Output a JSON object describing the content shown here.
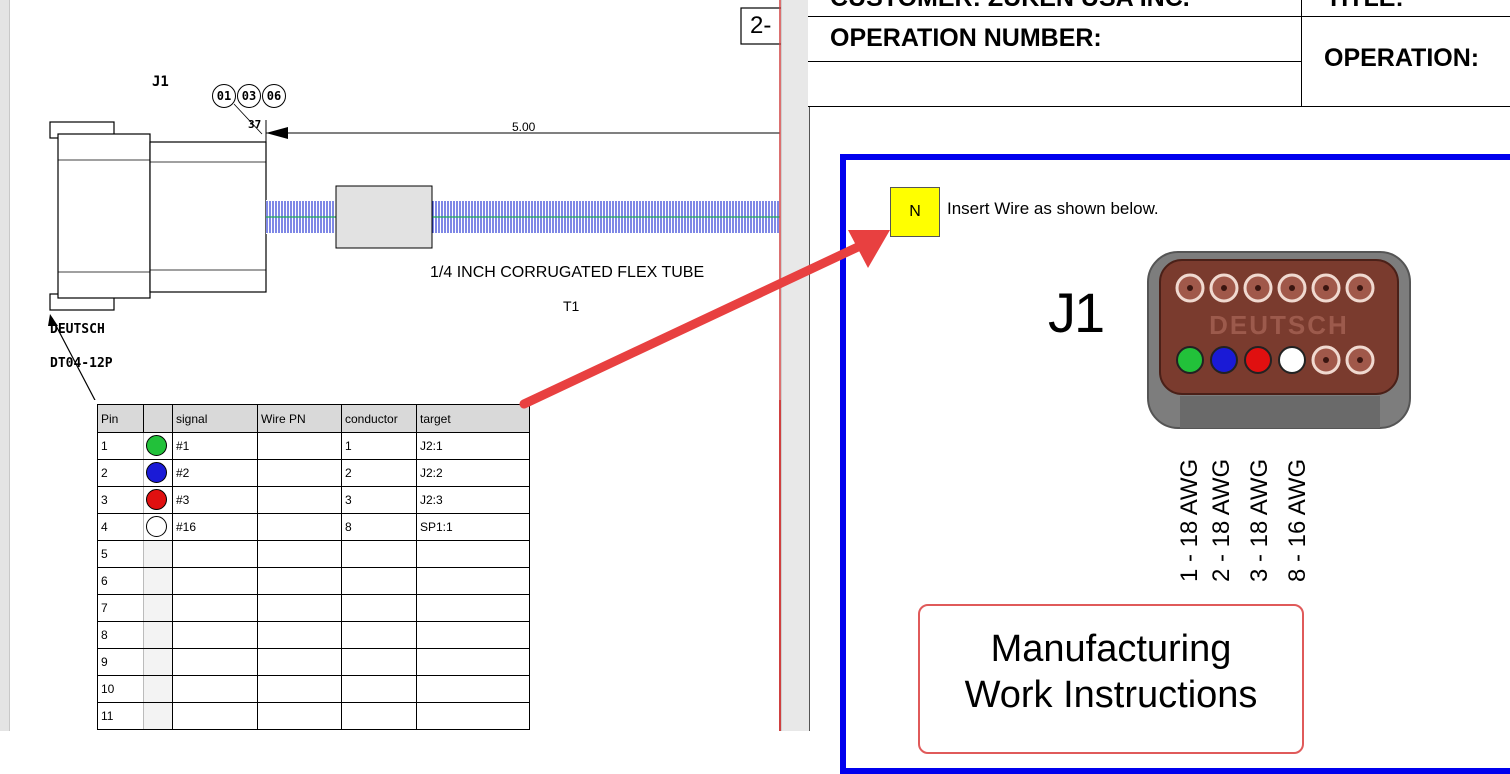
{
  "left_sheet": {
    "connector_ref": "J1",
    "callouts": [
      "01",
      "03",
      "06"
    ],
    "leader_number": "37",
    "dimension": "5.00",
    "tube_label": "1/4 INCH CORRUGATED FLEX TUBE",
    "tube_ref": "T1",
    "manufacturer": "DEUTSCH",
    "part_number": "DT04-12P",
    "sheet_tab": "2-"
  },
  "pin_table": {
    "headers": [
      "Pin",
      "",
      "signal",
      "Wire PN",
      "conductor",
      "target"
    ],
    "rows": [
      {
        "pin": "1",
        "color": "#22c13a",
        "signal": "#1",
        "wire_pn": "",
        "conductor": "1",
        "target": "J2:1"
      },
      {
        "pin": "2",
        "color": "#1a1ad6",
        "signal": "#2",
        "wire_pn": "",
        "conductor": "2",
        "target": "J2:2"
      },
      {
        "pin": "3",
        "color": "#e01010",
        "signal": "#3",
        "wire_pn": "",
        "conductor": "3",
        "target": "J2:3"
      },
      {
        "pin": "4",
        "color": "#ffffff",
        "signal": "#16",
        "wire_pn": "",
        "conductor": "8",
        "target": "SP1:1"
      },
      {
        "pin": "5",
        "color": "",
        "signal": "",
        "wire_pn": "",
        "conductor": "",
        "target": ""
      },
      {
        "pin": "6",
        "color": "",
        "signal": "",
        "wire_pn": "",
        "conductor": "",
        "target": ""
      },
      {
        "pin": "7",
        "color": "",
        "signal": "",
        "wire_pn": "",
        "conductor": "",
        "target": ""
      },
      {
        "pin": "8",
        "color": "",
        "signal": "",
        "wire_pn": "",
        "conductor": "",
        "target": ""
      },
      {
        "pin": "9",
        "color": "",
        "signal": "",
        "wire_pn": "",
        "conductor": "",
        "target": ""
      },
      {
        "pin": "10",
        "color": "",
        "signal": "",
        "wire_pn": "",
        "conductor": "",
        "target": ""
      },
      {
        "pin": "11",
        "color": "",
        "signal": "",
        "wire_pn": "",
        "conductor": "",
        "target": ""
      }
    ]
  },
  "right_sheet": {
    "customer_label": "CUSTOMER: ZUKEN USA INC.",
    "title_label": "TITLE:",
    "operation_number_label": "OPERATION NUMBER:",
    "operation_label": "OPERATION:",
    "note_badge": "N",
    "instruction": "Insert Wire as shown below.",
    "connector_label": "J1",
    "connector_brand": "DEUTSCH",
    "wire_labels": [
      "1 - 18 AWG",
      "2 - 18 AWG",
      "3 - 18 AWG",
      "8 - 16 AWG"
    ],
    "box_title_line1": "Manufacturing",
    "box_title_line2": "Work Instructions"
  },
  "colors": {
    "frame_blue": "#0000ee",
    "arrow_red": "#e84040",
    "connector_body": "#7a3b2e",
    "connector_housing": "#7d7d7d",
    "tube_blue": "#3a48d8",
    "badge_yellow": "#ffff00"
  }
}
